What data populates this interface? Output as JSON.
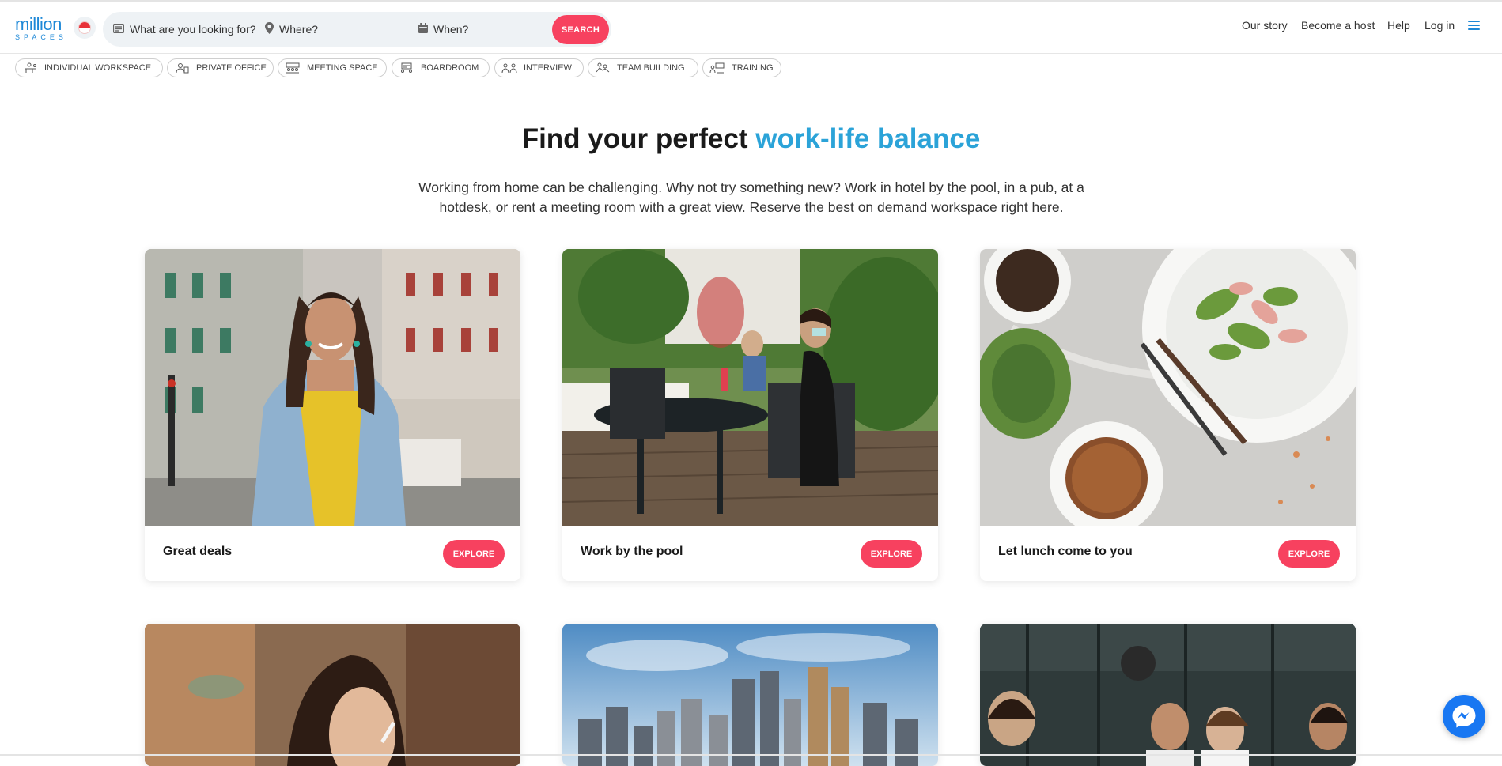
{
  "header": {
    "logo_top": "million",
    "logo_bottom": "SPACES",
    "search": {
      "what_placeholder": "What are you looking for?",
      "where_placeholder": "Where?",
      "when_placeholder": "When?",
      "button_label": "SEARCH"
    },
    "nav": [
      "Our story",
      "Become a host",
      "Help",
      "Log in"
    ]
  },
  "categories": [
    {
      "label": "INDIVIDUAL WORKSPACE",
      "icon": "individual-workspace-icon"
    },
    {
      "label": "PRIVATE OFFICE",
      "icon": "private-office-icon"
    },
    {
      "label": "MEETING SPACE",
      "icon": "meeting-space-icon"
    },
    {
      "label": "BOARDROOM",
      "icon": "boardroom-icon"
    },
    {
      "label": "INTERVIEW",
      "icon": "interview-icon"
    },
    {
      "label": "TEAM BUILDING",
      "icon": "team-building-icon"
    },
    {
      "label": "TRAINING",
      "icon": "training-icon"
    }
  ],
  "hero": {
    "title_plain": "Find your perfect ",
    "title_accent": "work-life balance",
    "subtitle": "Working from home can be challenging. Why not try something new? Work in hotel by the pool, in a pub, at a hotdesk, or rent a meeting room with a great view. Reserve the best on demand workspace right here."
  },
  "cards": [
    {
      "caption": "Great deals",
      "button": "EXPLORE"
    },
    {
      "caption": "Work by the pool",
      "button": "EXPLORE"
    },
    {
      "caption": "Let lunch come to you",
      "button": "EXPLORE"
    },
    {
      "caption": "",
      "button": ""
    },
    {
      "caption": "",
      "button": ""
    },
    {
      "caption": "",
      "button": ""
    }
  ],
  "colors": {
    "brand_blue": "#1e88d7",
    "accent_blue": "#2ba3d8",
    "cta_pink": "#f7415f",
    "search_bg": "#eef2f5",
    "messenger_blue": "#1877f2"
  },
  "icons": {
    "what": "list-icon",
    "where": "map-pin-icon",
    "when": "calendar-icon",
    "menu": "hamburger-menu-icon",
    "chat": "messenger-icon",
    "flag": "singapore-flag-icon"
  }
}
